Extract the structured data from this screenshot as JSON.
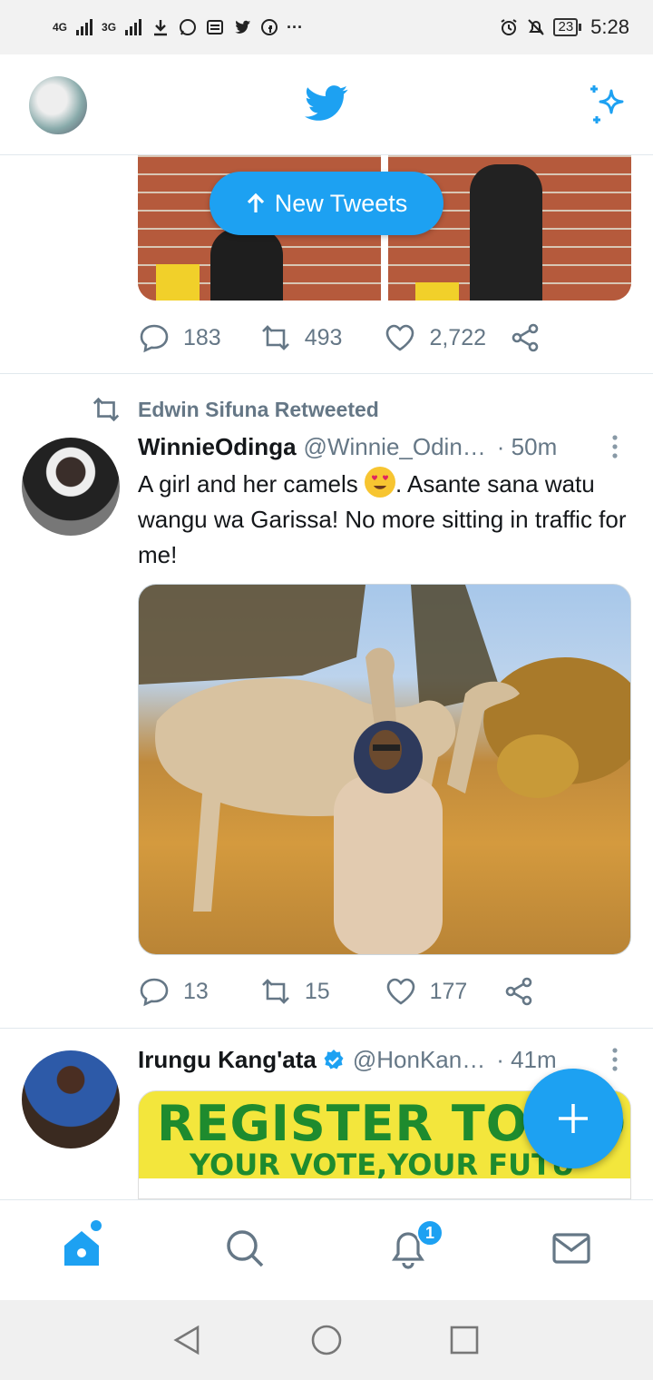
{
  "status_bar": {
    "net1": "4G",
    "net2": "3G",
    "battery": "23",
    "time": "5:28"
  },
  "header": {
    "logo_icon": "twitter-bird-icon",
    "sparkle_icon": "sparkle-icon"
  },
  "new_tweets_label": "New Tweets",
  "tweet1": {
    "replies": "183",
    "retweets": "493",
    "likes": "2,722"
  },
  "tweet2": {
    "retweeted_by": "Edwin Sifuna Retweeted",
    "name": "WinnieOdinga",
    "handle": "@Winnie_Odin…",
    "time": "· 50m",
    "text_part1": "A girl and her camels",
    "text_part2": ". Asante sana watu wangu wa Garissa! No more sitting in traffic for me!",
    "replies": "13",
    "retweets": "15",
    "likes": "177"
  },
  "tweet3": {
    "name": "Irungu Kang'ata",
    "handle": "@HonKan…",
    "time": "· 41m",
    "banner_title": "REGISTER TO VO",
    "banner_sub": "YOUR VOTE,YOUR FUTU"
  },
  "bottom_nav": {
    "notifications_badge": "1"
  },
  "colors": {
    "accent": "#1da1f2",
    "muted": "#657786",
    "divider": "#e1e8ed"
  }
}
